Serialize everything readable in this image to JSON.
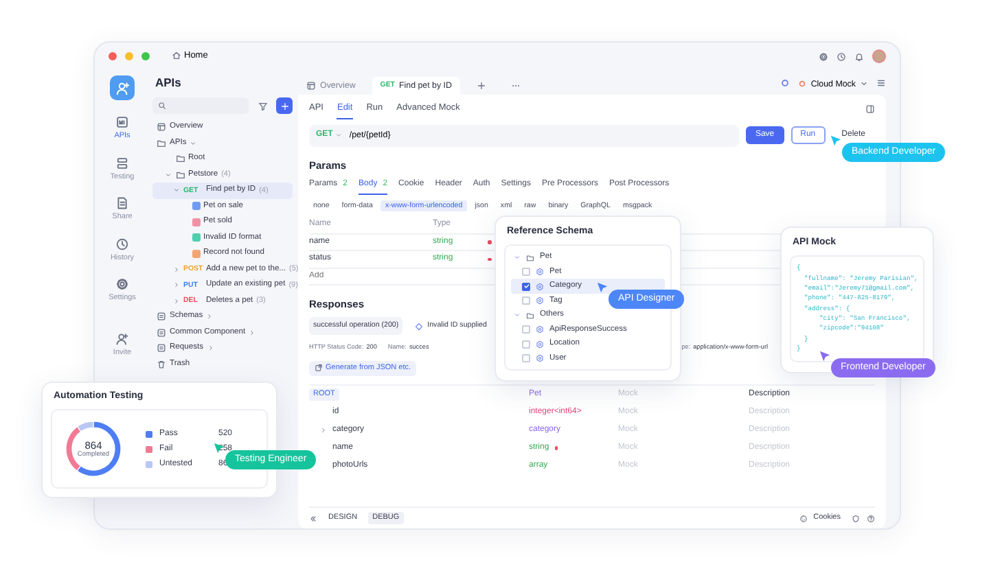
{
  "titlebar": {
    "home": "Home"
  },
  "rail": [
    {
      "label": "APIs",
      "selected": true
    },
    {
      "label": "Testing",
      "selected": false
    },
    {
      "label": "Share",
      "selected": false
    },
    {
      "label": "History",
      "selected": false
    },
    {
      "label": "Settings",
      "selected": false
    },
    {
      "label": "Invite",
      "selected": false
    }
  ],
  "sidebar": {
    "title": "APIs",
    "tree": [
      {
        "kind": "page",
        "label": "Overview"
      },
      {
        "kind": "folder",
        "label": "APIs",
        "expanded": true,
        "children": [
          {
            "kind": "folder",
            "label": "Root"
          },
          {
            "kind": "folder",
            "label": "Petstore",
            "count": "(4)",
            "expanded": true,
            "children": [
              {
                "kind": "endpoint",
                "method": "GET",
                "color": "#2fb36b",
                "label": "Find pet by ID",
                "count": "(4)",
                "expanded": true,
                "selected": true,
                "children": [
                  {
                    "kind": "example",
                    "label": "Pet on sale",
                    "color": "#6f9cf3"
                  },
                  {
                    "kind": "example",
                    "label": "Pet sold",
                    "color": "#f291a6"
                  },
                  {
                    "kind": "example",
                    "label": "Invalid ID format",
                    "color": "#4fcfae"
                  },
                  {
                    "kind": "example",
                    "label": "Record not found",
                    "color": "#f5a572"
                  }
                ]
              },
              {
                "kind": "endpoint",
                "method": "POST",
                "color": "#f0a02c",
                "label": "Add a new pet to the...",
                "count": "(5)",
                "expanded": false,
                "selected": false
              },
              {
                "kind": "endpoint",
                "method": "PUT",
                "color": "#3f7cf2",
                "label": "Update an existing pet",
                "count": "(9)",
                "expanded": false,
                "selected": false
              },
              {
                "kind": "endpoint",
                "method": "DEL",
                "color": "#ec4d5e",
                "label": "Deletes a pet",
                "count": "(3)",
                "expanded": false,
                "selected": false
              }
            ]
          }
        ]
      },
      {
        "kind": "section",
        "label": "Schemas",
        "expanded": false
      },
      {
        "kind": "section",
        "label": "Common Component",
        "expanded": false
      },
      {
        "kind": "section",
        "label": "Requests",
        "expanded": false
      },
      {
        "kind": "trash",
        "label": "Trash"
      }
    ]
  },
  "tabs": [
    {
      "label": "Overview",
      "selected": false
    },
    {
      "method": "GET",
      "color": "#2fb36b",
      "label": "Find pet by ID",
      "selected": true
    }
  ],
  "environment": "Cloud Mock",
  "editor_tabs": [
    {
      "label": "API",
      "selected": false
    },
    {
      "label": "Edit",
      "selected": true
    },
    {
      "label": "Run",
      "selected": false
    },
    {
      "label": "Advanced Mock",
      "selected": false
    }
  ],
  "request": {
    "method": "GET",
    "path": "/pet/{petId}",
    "buttons": [
      {
        "label": "Save",
        "kind": "primary"
      },
      {
        "label": "Run",
        "kind": "outline"
      },
      {
        "label": "Delete",
        "kind": "plain"
      }
    ]
  },
  "params": {
    "title": "Params",
    "tabs": [
      {
        "label": "Params",
        "count": "2",
        "selected": false
      },
      {
        "label": "Body",
        "count": "2",
        "selected": true
      },
      {
        "label": "Cookie",
        "selected": false
      },
      {
        "label": "Header",
        "selected": false
      },
      {
        "label": "Auth",
        "selected": false
      },
      {
        "label": "Settings",
        "selected": false
      },
      {
        "label": "Pre Processors",
        "selected": false
      },
      {
        "label": "Post Processors",
        "selected": false
      }
    ],
    "body_types": [
      {
        "label": "none",
        "selected": false
      },
      {
        "label": "form-data",
        "selected": false
      },
      {
        "label": "x-www-form-urlencoded",
        "selected": true
      },
      {
        "label": "json",
        "selected": false
      },
      {
        "label": "xml",
        "selected": false
      },
      {
        "label": "raw",
        "selected": false
      },
      {
        "label": "binary",
        "selected": false
      },
      {
        "label": "GraphQL",
        "selected": false
      },
      {
        "label": "msgpack",
        "selected": false
      }
    ],
    "columns": [
      "Name",
      "Type"
    ],
    "rows": [
      {
        "name": "name",
        "type": "string",
        "required": true
      },
      {
        "name": "status",
        "type": "string",
        "required": true
      }
    ],
    "add_placeholder": "Add"
  },
  "responses": {
    "title": "Responses",
    "tabs": [
      {
        "label": "successful operation (200)",
        "selected": true
      },
      {
        "label": "Invalid ID supplied",
        "selected": false
      }
    ],
    "fields": [
      {
        "label": "HTTP Status Code:",
        "value": "200"
      },
      {
        "label": "Name:",
        "value": "succes"
      },
      {
        "label": "pe:",
        "value": "application/x-www-form-url"
      }
    ],
    "generate": "Generate from JSON etc.",
    "root": {
      "name": "ROOT",
      "type": "Pet",
      "mock": "Mock",
      "description": "Description"
    },
    "fields_schema": [
      {
        "name": "id",
        "type": "integer<int64>",
        "color": "#e0457b",
        "required": false,
        "expandable": false,
        "mock": "Mock",
        "description": "Description"
      },
      {
        "name": "category",
        "type": "category",
        "color": "#8a63e8",
        "required": false,
        "expandable": true,
        "mock": "Mock",
        "description": "Description"
      },
      {
        "name": "name",
        "type": "string",
        "color": "#36a852",
        "required": true,
        "expandable": false,
        "mock": "Mock",
        "description": "Description"
      },
      {
        "name": "photoUrls",
        "type": "array",
        "color": "#36a852",
        "required": false,
        "expandable": false,
        "mock": "Mock",
        "description": "Description"
      }
    ]
  },
  "bottom_bar": {
    "modes": [
      {
        "label": "DESIGN",
        "selected": false
      },
      {
        "label": "DEBUG",
        "selected": true
      }
    ],
    "cookies": "Cookies"
  },
  "reference_schema": {
    "title": "Reference Schema",
    "groups": [
      {
        "label": "Pet",
        "expanded": true,
        "children": [
          {
            "label": "Pet",
            "checked": false,
            "selected": false
          },
          {
            "label": "Category",
            "checked": true,
            "selected": true
          },
          {
            "label": "Tag",
            "checked": false,
            "selected": false
          }
        ]
      },
      {
        "label": "Others",
        "expanded": true,
        "children": [
          {
            "label": "ApiResponseSuccess",
            "checked": false,
            "selected": false
          },
          {
            "label": "Location",
            "checked": false,
            "selected": false
          },
          {
            "label": "User",
            "checked": false,
            "selected": false
          }
        ]
      }
    ]
  },
  "api_mock": {
    "title": "API Mock",
    "lines": [
      "{",
      "  \"fullname\": \"Jeremy Parisian\",",
      "  \"email\":\"Jeremy71@gmail.com\",",
      "  \"phone\": \"447-825-8179\",",
      "  \"address\": {",
      "      \"city\": \"San Francisco\",",
      "      \"zipcode\":\"94108\"",
      "  }",
      "}"
    ]
  },
  "automation_testing": {
    "title": "Automation Testing",
    "total": "864",
    "total_label": "Completed",
    "legend": [
      {
        "value": "520",
        "color": "#4f7df3"
      },
      {
        "value": "258",
        "color": "#f17a94"
      },
      {
        "value": "86",
        "color": "#b9c7f6"
      }
    ],
    "chart_data": {
      "type": "donut",
      "categories": [
        "Pass",
        "Fail",
        "Untested"
      ],
      "values": [
        60.19,
        29.86,
        9.95
      ]
    }
  },
  "callouts": [
    {
      "label": "Backend Developer",
      "color": "#1cc3ee"
    },
    {
      "label": "API Designer",
      "color": "#4c86f7"
    },
    {
      "label": "Frontend Developer",
      "color": "#8b6cf0"
    },
    {
      "label": "Testing Engineer",
      "color": "#15c49c"
    }
  ]
}
